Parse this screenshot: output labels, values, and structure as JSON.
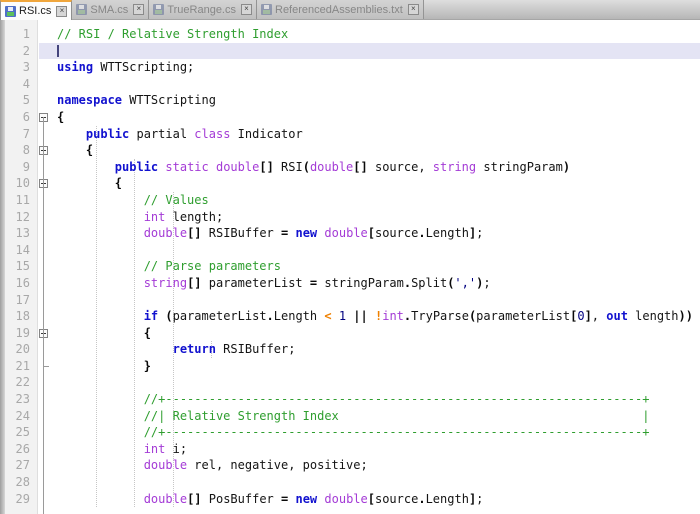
{
  "tab_bar": {
    "close_glyph": "×",
    "tabs": [
      {
        "label": "RSI.cs",
        "active": true
      },
      {
        "label": "SMA.cs",
        "active": false
      },
      {
        "label": "TrueRange.cs",
        "active": false
      },
      {
        "label": "ReferencedAssemblies.txt",
        "active": false
      }
    ]
  },
  "colors": {
    "keyword": "#1212cf",
    "type": "#a43bd6",
    "comment": "#2f9e2f",
    "number_literal": "#000080",
    "operator": "#ef8000",
    "current_line_highlight": "#e4e4f4",
    "active_tab_accent": "#f0a63c",
    "tab_icon_blue": "#4f6fc8",
    "tab_icon_green": "#5cc05c"
  },
  "editor": {
    "current_line": 2,
    "lines": [
      {
        "num": 1,
        "fold": null,
        "segs": [
          [
            "cm",
            "// RSI / Relative Strength Index"
          ]
        ]
      },
      {
        "num": 2,
        "fold": null,
        "segs": []
      },
      {
        "num": 3,
        "fold": null,
        "segs": [
          [
            "kw",
            "using"
          ],
          [
            "pl",
            " WTTScripting;"
          ]
        ]
      },
      {
        "num": 4,
        "fold": null,
        "segs": []
      },
      {
        "num": 5,
        "fold": null,
        "segs": [
          [
            "kw",
            "namespace"
          ],
          [
            "pl",
            " WTTScripting"
          ]
        ]
      },
      {
        "num": 6,
        "fold": "open",
        "segs": [
          [
            "br",
            "{"
          ]
        ]
      },
      {
        "num": 7,
        "fold": null,
        "segs": [
          [
            "pl",
            "    "
          ],
          [
            "kw",
            "public"
          ],
          [
            "pl",
            " partial "
          ],
          [
            "ty",
            "class"
          ],
          [
            "pl",
            " Indicator"
          ]
        ]
      },
      {
        "num": 8,
        "fold": "open",
        "segs": [
          [
            "pl",
            "    "
          ],
          [
            "br",
            "{"
          ]
        ]
      },
      {
        "num": 9,
        "fold": null,
        "segs": [
          [
            "pl",
            "        "
          ],
          [
            "kw",
            "public"
          ],
          [
            "pl",
            " "
          ],
          [
            "ty",
            "static"
          ],
          [
            "pl",
            " "
          ],
          [
            "ty",
            "double"
          ],
          [
            "br",
            "[]"
          ],
          [
            "pl",
            " RSI"
          ],
          [
            "br",
            "("
          ],
          [
            "ty",
            "double"
          ],
          [
            "br",
            "[]"
          ],
          [
            "pl",
            " source, "
          ],
          [
            "ty",
            "string"
          ],
          [
            "pl",
            " stringParam"
          ],
          [
            "br",
            ")"
          ]
        ]
      },
      {
        "num": 10,
        "fold": "open",
        "segs": [
          [
            "pl",
            "        "
          ],
          [
            "br",
            "{"
          ]
        ]
      },
      {
        "num": 11,
        "fold": null,
        "segs": [
          [
            "pl",
            "            "
          ],
          [
            "cm",
            "// Values"
          ]
        ]
      },
      {
        "num": 12,
        "fold": null,
        "segs": [
          [
            "pl",
            "            "
          ],
          [
            "ty",
            "int"
          ],
          [
            "pl",
            " length;"
          ]
        ]
      },
      {
        "num": 13,
        "fold": null,
        "segs": [
          [
            "pl",
            "            "
          ],
          [
            "ty",
            "double"
          ],
          [
            "br",
            "[]"
          ],
          [
            "pl",
            " RSIBuffer "
          ],
          [
            "br",
            "="
          ],
          [
            "pl",
            " "
          ],
          [
            "kw",
            "new"
          ],
          [
            "pl",
            " "
          ],
          [
            "ty",
            "double"
          ],
          [
            "br",
            "["
          ],
          [
            "pl",
            "source"
          ],
          [
            "br",
            "."
          ],
          [
            "pl",
            "Length"
          ],
          [
            "br",
            "]"
          ],
          [
            "pl",
            ";"
          ]
        ]
      },
      {
        "num": 14,
        "fold": null,
        "segs": []
      },
      {
        "num": 15,
        "fold": null,
        "segs": [
          [
            "pl",
            "            "
          ],
          [
            "cm",
            "// Parse parameters"
          ]
        ]
      },
      {
        "num": 16,
        "fold": null,
        "segs": [
          [
            "pl",
            "            "
          ],
          [
            "ty",
            "string"
          ],
          [
            "br",
            "[]"
          ],
          [
            "pl",
            " parameterList "
          ],
          [
            "br",
            "="
          ],
          [
            "pl",
            " stringParam"
          ],
          [
            "br",
            "."
          ],
          [
            "pl",
            "Split"
          ],
          [
            "br",
            "("
          ],
          [
            "nm",
            "','"
          ],
          [
            "br",
            ")"
          ],
          [
            "pl",
            ";"
          ]
        ]
      },
      {
        "num": 17,
        "fold": null,
        "segs": []
      },
      {
        "num": 18,
        "fold": null,
        "segs": [
          [
            "pl",
            "            "
          ],
          [
            "kw",
            "if"
          ],
          [
            "pl",
            " "
          ],
          [
            "br",
            "("
          ],
          [
            "pl",
            "parameterList"
          ],
          [
            "br",
            "."
          ],
          [
            "pl",
            "Length "
          ],
          [
            "op",
            "<"
          ],
          [
            "pl",
            " "
          ],
          [
            "nm",
            "1"
          ],
          [
            "pl",
            " "
          ],
          [
            "br",
            "||"
          ],
          [
            "pl",
            " "
          ],
          [
            "op",
            "!"
          ],
          [
            "ty",
            "int"
          ],
          [
            "br",
            "."
          ],
          [
            "pl",
            "TryParse"
          ],
          [
            "br",
            "("
          ],
          [
            "pl",
            "parameterList"
          ],
          [
            "br",
            "["
          ],
          [
            "nm",
            "0"
          ],
          [
            "br",
            "]"
          ],
          [
            "pl",
            ", "
          ],
          [
            "kw",
            "out"
          ],
          [
            "pl",
            " length"
          ],
          [
            "br",
            "))"
          ]
        ]
      },
      {
        "num": 19,
        "fold": "open",
        "segs": [
          [
            "pl",
            "            "
          ],
          [
            "br",
            "{"
          ]
        ]
      },
      {
        "num": 20,
        "fold": null,
        "segs": [
          [
            "pl",
            "                "
          ],
          [
            "kw",
            "return"
          ],
          [
            "pl",
            " RSIBuffer;"
          ]
        ]
      },
      {
        "num": 21,
        "fold": "end",
        "segs": [
          [
            "pl",
            "            "
          ],
          [
            "br",
            "}"
          ]
        ]
      },
      {
        "num": 22,
        "fold": null,
        "segs": []
      },
      {
        "num": 23,
        "fold": null,
        "segs": [
          [
            "pl",
            "            "
          ],
          [
            "cm",
            "//+------------------------------------------------------------------+"
          ]
        ]
      },
      {
        "num": 24,
        "fold": null,
        "segs": [
          [
            "pl",
            "            "
          ],
          [
            "cm",
            "//| Relative Strength Index                                          |"
          ]
        ]
      },
      {
        "num": 25,
        "fold": null,
        "segs": [
          [
            "pl",
            "            "
          ],
          [
            "cm",
            "//+------------------------------------------------------------------+"
          ]
        ]
      },
      {
        "num": 26,
        "fold": null,
        "segs": [
          [
            "pl",
            "            "
          ],
          [
            "ty",
            "int"
          ],
          [
            "pl",
            " i;"
          ]
        ]
      },
      {
        "num": 27,
        "fold": null,
        "segs": [
          [
            "pl",
            "            "
          ],
          [
            "ty",
            "double"
          ],
          [
            "pl",
            " rel, negative, positive;"
          ]
        ]
      },
      {
        "num": 28,
        "fold": null,
        "segs": []
      },
      {
        "num": 29,
        "fold": null,
        "segs": [
          [
            "pl",
            "            "
          ],
          [
            "ty",
            "double"
          ],
          [
            "br",
            "[]"
          ],
          [
            "pl",
            " PosBuffer "
          ],
          [
            "br",
            "="
          ],
          [
            "pl",
            " "
          ],
          [
            "kw",
            "new"
          ],
          [
            "pl",
            " "
          ],
          [
            "ty",
            "double"
          ],
          [
            "br",
            "["
          ],
          [
            "pl",
            "source"
          ],
          [
            "br",
            "."
          ],
          [
            "pl",
            "Length"
          ],
          [
            "br",
            "]"
          ],
          [
            "pl",
            ";"
          ]
        ]
      }
    ]
  }
}
